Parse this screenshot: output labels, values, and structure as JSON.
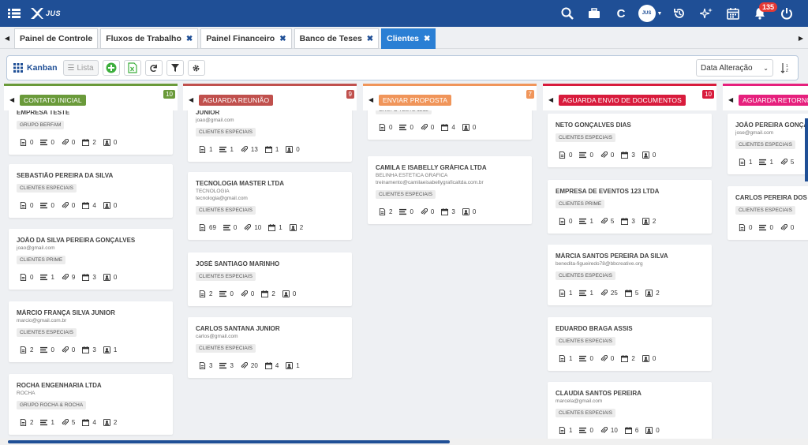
{
  "app": {
    "brand": "JUS",
    "notifications": "135"
  },
  "topbar": {
    "c_label": "C",
    "avatar_label": "JUS"
  },
  "tabs": [
    {
      "label": "Painel de Controle",
      "closable": false,
      "active": false
    },
    {
      "label": "Fluxos de Trabalho",
      "closable": true,
      "active": false
    },
    {
      "label": "Painel Financeiro",
      "closable": true,
      "active": false
    },
    {
      "label": "Banco de Teses",
      "closable": true,
      "active": false
    },
    {
      "label": "Clientes",
      "closable": true,
      "active": true
    }
  ],
  "toolbar": {
    "kanban_label": "Kanban",
    "lista_label": "Lista",
    "sort_label": "Data Alteração"
  },
  "columns": [
    {
      "title": "CONTATO INICIAL",
      "count": "10",
      "color": "#6a9a3a",
      "border": "#6a9a3a",
      "cards": [
        {
          "title": "EMPRESA TESTE",
          "sub": [],
          "tag": "GRUPO BERFAM",
          "stats": [
            "0",
            "0",
            "0",
            "2",
            "0"
          ]
        },
        {
          "title": "SEBASTIÃO PEREIRA DA SILVA",
          "sub": [],
          "tag": "CLIENTES ESPECIAIS",
          "stats": [
            "0",
            "0",
            "0",
            "4",
            "0"
          ]
        },
        {
          "title": "JOÃO DA SILVA PEREIRA GONÇALVES",
          "sub": [
            "joao@gmail.com"
          ],
          "tag": "CLIENTES PRIME",
          "stats": [
            "0",
            "1",
            "9",
            "3",
            "0"
          ]
        },
        {
          "title": "MÁRCIO FRANÇA SILVA JUNIOR",
          "sub": [
            "marcio@gmail.com.br"
          ],
          "tag": "CLIENTES ESPECIAIS",
          "stats": [
            "2",
            "0",
            "0",
            "3",
            "1"
          ]
        },
        {
          "title": "ROCHA ENGENHARIA LTDA",
          "sub": [
            "ROCHA"
          ],
          "tag": "GRUPO ROCHA & ROCHA",
          "stats": [
            "2",
            "1",
            "5",
            "4",
            "2"
          ]
        }
      ]
    },
    {
      "title": "AGUARDA REUNIÃO",
      "count": "9",
      "color": "#c0504d",
      "border": "#c0504d",
      "cards": [
        {
          "title": "JUNIOR",
          "sub": [
            "joao@gmail.com"
          ],
          "tag": "CLIENTES ESPECIAIS",
          "stats": [
            "1",
            "1",
            "13",
            "1",
            "0"
          ]
        },
        {
          "title": "TECNOLOGIA MASTER LTDA",
          "sub": [
            "TECNOLOGIA",
            "tecnologia@gmail.com"
          ],
          "tag": "CLIENTES ESPECIAIS",
          "stats": [
            "69",
            "0",
            "10",
            "1",
            "2"
          ]
        },
        {
          "title": "JOSÉ SANTIAGO MARINHO",
          "sub": [],
          "tag": "CLIENTES ESPECIAIS",
          "stats": [
            "2",
            "0",
            "0",
            "2",
            "0"
          ]
        },
        {
          "title": "CARLOS SANTANA JUNIOR",
          "sub": [
            "carlos@gmail.com"
          ],
          "tag": "CLIENTES ESPECIAIS",
          "stats": [
            "3",
            "3",
            "20",
            "4",
            "1"
          ]
        }
      ]
    },
    {
      "title": "ENVIAR PROPOSTA",
      "count": "7",
      "color": "#f0955a",
      "border": "#f0955a",
      "cards": [
        {
          "title": "",
          "sub": [],
          "tag": "GRUPO TESTE 1212",
          "stats": [
            "0",
            "0",
            "0",
            "4",
            "0"
          ]
        },
        {
          "title": "CAMILA E ISABELLY GRÁFICA LTDA",
          "sub": [
            "BELINHA ESTÉTICA GRÁFICA",
            "treinamento@camilaeisabellygraficaltda.com.br"
          ],
          "tag": "CLIENTES ESPECIAIS",
          "stats": [
            "2",
            "0",
            "0",
            "3",
            "0"
          ]
        }
      ]
    },
    {
      "title": "AGUARDA ENVIO DE DOCUMENTOS",
      "count": "10",
      "color": "#d81b3c",
      "border": "#d81b3c",
      "cards": [
        {
          "title": "NETO GONÇALVES DIAS",
          "sub": [],
          "tag": "CLIENTES ESPECIAIS",
          "stats": [
            "0",
            "0",
            "0",
            "3",
            "0"
          ]
        },
        {
          "title": "EMPRESA DE EVENTOS 123 LTDA",
          "sub": [],
          "tag": "CLIENTES PRIME",
          "stats": [
            "0",
            "1",
            "5",
            "3",
            "2"
          ]
        },
        {
          "title": "MÁRCIA SANTOS PEREIRA DA SILVA",
          "sub": [
            "benedita-figueiredo78@bbcreative.org"
          ],
          "tag": "CLIENTES ESPECIAIS",
          "stats": [
            "1",
            "1",
            "25",
            "5",
            "2"
          ]
        },
        {
          "title": "EDUARDO BRAGA ASSIS",
          "sub": [],
          "tag": "CLIENTES ESPECIAIS",
          "stats": [
            "1",
            "0",
            "0",
            "2",
            "0"
          ]
        },
        {
          "title": "CLAUDIA SANTOS PEREIRA",
          "sub": [
            "marcela@gmail.com"
          ],
          "tag": "CLIENTES ESPECIAIS",
          "stats": [
            "1",
            "0",
            "10",
            "6",
            "0"
          ]
        }
      ]
    },
    {
      "title": "AGUARDA RETORNO S",
      "count": "",
      "color": "#e6207d",
      "border": "#e6207d",
      "cards": [
        {
          "title": "JOÃO PEREIRA GONÇALV",
          "sub": [
            "jose@gmail.com"
          ],
          "tag": "CLIENTES ESPECIAIS",
          "stats": [
            "1",
            "1",
            "5",
            "",
            ""
          ]
        },
        {
          "title": "CARLOS PEREIRA DOS SA",
          "sub": [],
          "tag": "CLIENTES ESPECIAIS",
          "stats": [
            "0",
            "0",
            "0",
            "",
            ""
          ]
        }
      ]
    }
  ],
  "stat_icons": [
    "document-icon",
    "list-icon",
    "paperclip-icon",
    "calendar-icon",
    "contact-icon"
  ]
}
